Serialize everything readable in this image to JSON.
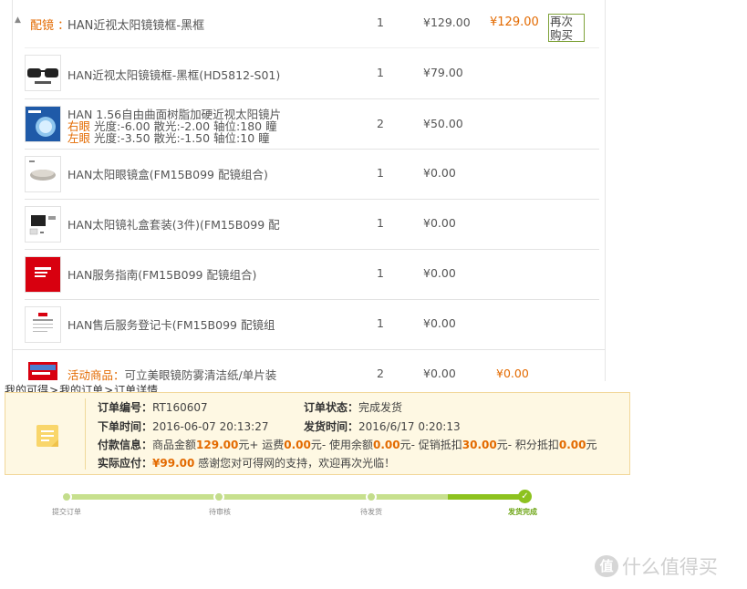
{
  "order_header": {
    "tag": "配镜 ：",
    "name": "HAN近视太阳镜镜框-黑框",
    "qty": "1",
    "price": "¥129.00",
    "subtotal": "¥129.00",
    "reorder": "再次购买"
  },
  "items": [
    {
      "name": "HAN近视太阳镜镜框-黑框(HD5812-S01)",
      "qty": "1",
      "price": "¥79.00"
    },
    {
      "name": "HAN 1.56自由曲面树脂加硬近视太阳镜片",
      "right_label": "右眼",
      "right_detail": "光度:-6.00 散光:-2.00 轴位:180 瞳",
      "left_label": "左眼",
      "left_detail": "光度:-3.50 散光:-1.50 轴位:10 瞳",
      "qty": "2",
      "price": "¥50.00"
    },
    {
      "name": "HAN太阳眼镜盒(FM15B099 配镜组合)",
      "qty": "1",
      "price": "¥0.00"
    },
    {
      "name": "HAN太阳镜礼盒套装(3件)(FM15B099 配",
      "qty": "1",
      "price": "¥0.00"
    },
    {
      "name": "HAN服务指南(FM15B099 配镜组合)",
      "qty": "1",
      "price": "¥0.00"
    },
    {
      "name": "HAN售后服务登记卡(FM15B099 配镜组",
      "qty": "1",
      "price": "¥0.00"
    }
  ],
  "promo": {
    "tag": "活动商品：",
    "name": "可立美眼镜防雾清洁纸/单片装",
    "qty": "2",
    "price": "¥0.00",
    "subtotal": "¥0.00"
  },
  "breadcrumb": {
    "a": "我的可得",
    "sep1": ">",
    "b": "我的订单",
    "sep2": ">",
    "c": "订单详情"
  },
  "details": {
    "order_no_label": "订单编号：",
    "order_no": "RT160607",
    "status_label": "订单状态：",
    "status": "完成发货",
    "order_time_label": "下单时间：",
    "order_time": "2016-06-07 20:13:27",
    "ship_time_label": "发货时间：",
    "ship_time": "2016/6/17 0:20:13",
    "pay_label": "付款信息：",
    "pay_t1": "商品金额",
    "pay_v1": "129.00",
    "pay_t2": "元+ 运费",
    "pay_v2": "0.00",
    "pay_t3": "元- 使用余额",
    "pay_v3": "0.00",
    "pay_t4": "元- 促销抵扣",
    "pay_v4": "30.00",
    "pay_t5": "元- 积分抵扣",
    "pay_v5": "0.00",
    "pay_t6": "元",
    "actual_label": "实际应付：",
    "actual": "¥99.00",
    "thanks": "感谢您对可得网的支持，欢迎再次光临！"
  },
  "progress": {
    "steps": [
      "提交订单",
      "待审核",
      "待发货",
      "发货完成"
    ],
    "completed_steps": 4
  },
  "watermark": {
    "text": "什么值得买"
  },
  "colors": {
    "accent_orange": "#e36a00",
    "progress_green": "#8dc21f",
    "progress_light": "#c7e08e",
    "info_bg": "#fef8e3"
  }
}
